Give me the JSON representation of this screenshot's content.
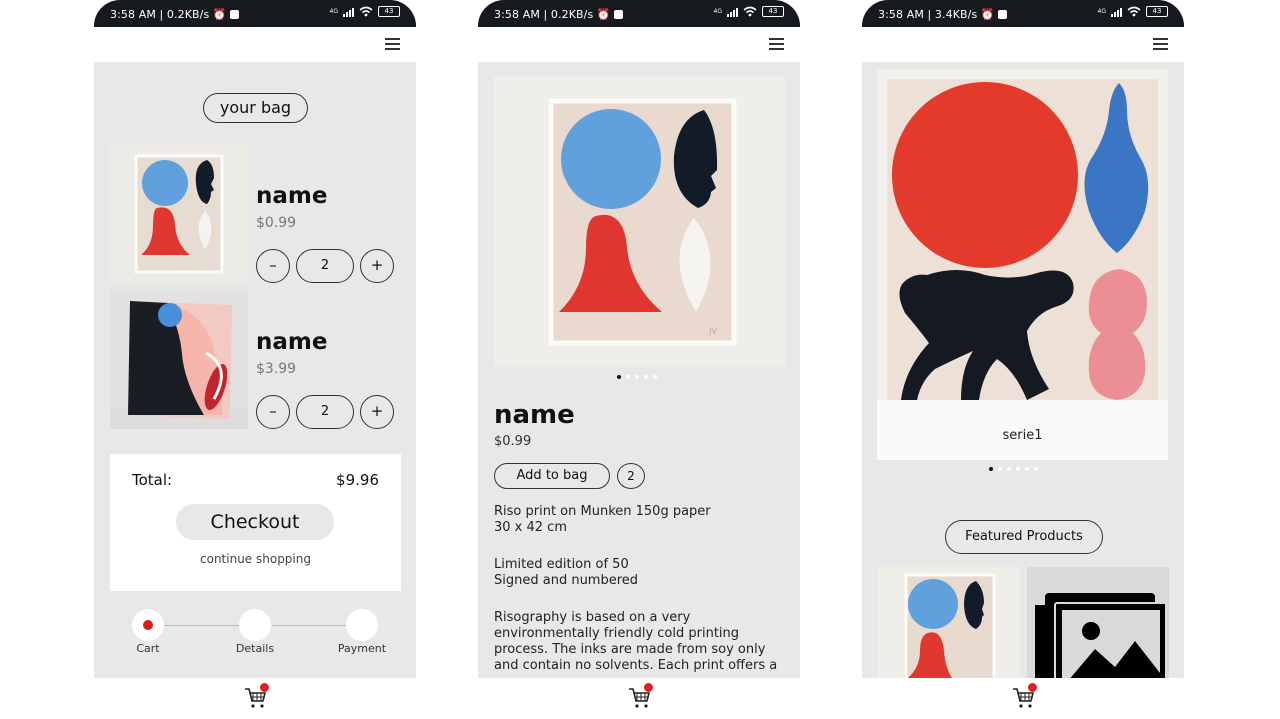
{
  "colors": {
    "accent": "#e02020",
    "panel_bg": "#e8e8e8",
    "status_bar": "#16191d"
  },
  "screens": [
    {
      "status": {
        "time": "3:58 AM | 0.2KB/s",
        "network": "4G",
        "battery": "43"
      },
      "bag_title": "your bag",
      "items": [
        {
          "name": "name",
          "price": "$0.99",
          "qty": "2",
          "minus": "–",
          "plus": "+"
        },
        {
          "name": "name",
          "price": "$3.99",
          "qty": "2",
          "minus": "–",
          "plus": "+"
        }
      ],
      "total_label": "Total:",
      "total_value": "$9.96",
      "checkout_label": "Checkout",
      "continue_label": "continue shopping",
      "steps": [
        "Cart",
        "Details",
        "Payment"
      ],
      "active_step": "Cart"
    },
    {
      "status": {
        "time": "3:58 AM | 0.2KB/s",
        "network": "4G",
        "battery": "43"
      },
      "product": {
        "name": "name",
        "price": "$0.99"
      },
      "add_to_bag_label": "Add to bag",
      "bag_count": "2",
      "image_carousel": {
        "count": 5,
        "active": 1
      },
      "description": [
        "Riso print on Munken 150g paper\n30 x 42 cm",
        "Limited edition of 50\nSigned and numbered",
        "Risography is based on a very\nenvironmentally friendly cold printing\nprocess. The inks are made from soy only\nand contain no solvents. Each print offers a"
      ]
    },
    {
      "status": {
        "time": "3:58 AM | 3.4KB/s",
        "network": "4G",
        "battery": "43"
      },
      "carousel_caption": "serie1",
      "carousel": {
        "count": 6,
        "active": 1
      },
      "featured_label": "Featured Products"
    }
  ],
  "icons": {
    "menu": "hamburger-menu-icon",
    "cart": "shopping-cart-icon",
    "placeholder": "image-placeholder-icon",
    "alarm": "alarm-icon",
    "wifi": "wifi-icon"
  }
}
